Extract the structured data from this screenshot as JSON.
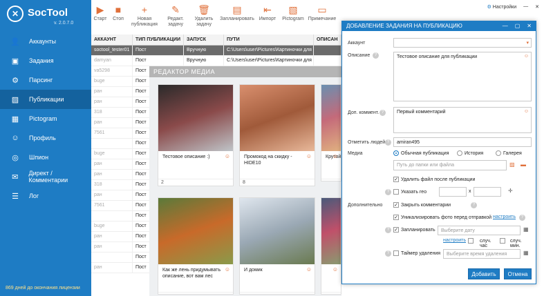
{
  "app": {
    "brand": "SocTool",
    "version": "v. 2.0.7.0",
    "license": "869 дней до окончания лицензии"
  },
  "sidebar": {
    "items": [
      {
        "label": "Аккаунты",
        "icon": "users-icon"
      },
      {
        "label": "Задания",
        "icon": "box-icon"
      },
      {
        "label": "Парсинг",
        "icon": "parse-icon"
      },
      {
        "label": "Публикации",
        "icon": "image-icon"
      },
      {
        "label": "Pictogram",
        "icon": "picture-icon"
      },
      {
        "label": "Профиль",
        "icon": "profile-icon"
      },
      {
        "label": "Шпион",
        "icon": "binoculars-icon"
      },
      {
        "label": "Директ / Комментарии",
        "icon": "mail-icon"
      },
      {
        "label": "Лог",
        "icon": "list-icon"
      }
    ]
  },
  "toolbar": {
    "start": "Старт",
    "stop": "Стоп",
    "new_pub": "Новая публикация",
    "edit_task": "Редакт. задачу",
    "delete_task": "Удалить задачу",
    "schedule": "Запланировать",
    "import": "Импорт",
    "pictogram": "Pictogram",
    "note": "Примечание",
    "settings": "Настройки"
  },
  "table": {
    "headers": [
      "АККАУНТ",
      "ТИП ПУБЛИКАЦИИ",
      "ЗАПУСК",
      "ПУТИ",
      "ОПИСАН"
    ],
    "rows": [
      [
        "soctool_tester01",
        "Пост",
        "Вручную",
        "C:\\Users\\user\\Pictures\\Картиночки для н",
        ""
      ],
      [
        "damyan",
        "Пост",
        "Вручную",
        "C:\\Users\\user\\Pictures\\Картиночки для н",
        ""
      ],
      [
        "va5298",
        "Пост",
        "",
        "",
        ""
      ],
      [
        "buge",
        "Пост",
        "",
        "",
        ""
      ],
      [
        "ран",
        "Пост",
        "",
        "",
        ""
      ],
      [
        "ран",
        "Пост",
        "",
        "",
        ""
      ],
      [
        "318",
        "Пост",
        "",
        "",
        ""
      ],
      [
        "ран",
        "Пост",
        "",
        "",
        ""
      ],
      [
        "7561",
        "Пост",
        "",
        "",
        ""
      ],
      [
        "",
        "Пост",
        "",
        "",
        ""
      ],
      [
        "buge",
        "Пост",
        "",
        "",
        ""
      ],
      [
        "ран",
        "Пост",
        "",
        "",
        ""
      ],
      [
        "ран",
        "Пост",
        "",
        "",
        ""
      ],
      [
        "318",
        "Пост",
        "",
        "",
        ""
      ],
      [
        "ран",
        "Пост",
        "",
        "",
        ""
      ],
      [
        "7561",
        "Пост",
        "",
        "",
        ""
      ],
      [
        "",
        "Пост",
        "",
        "",
        ""
      ],
      [
        "buge",
        "Пост",
        "",
        "",
        ""
      ],
      [
        "ран",
        "Пост",
        "",
        "",
        ""
      ],
      [
        "ран",
        "Пост",
        "",
        "",
        ""
      ],
      [
        "",
        "Пост",
        "",
        "",
        ""
      ],
      [
        "ран",
        "Пост",
        "",
        "",
        ""
      ]
    ]
  },
  "media": {
    "title": "РЕДАКТОР МЕДИА",
    "cards": [
      {
        "desc": "Тестовое описание :)",
        "num": "2",
        "colors": [
          "#2a2a2a",
          "#8a4a4a",
          "#bfc4c8"
        ]
      },
      {
        "desc": "Промокод на скидку - HIDE10",
        "num": "8",
        "colors": [
          "#d98f6e",
          "#a05a3a",
          "#e8b89a"
        ]
      },
      {
        "desc": "Крутой",
        "num": "",
        "colors": [
          "#6a8fb0",
          "#c46a7a",
          "#e0b080"
        ]
      },
      {
        "desc": "Как же лень придумывать описание, вот вам лес",
        "num": "",
        "colors": [
          "#5a7a3a",
          "#c86a2a",
          "#8a9a4a"
        ]
      },
      {
        "desc": "И домик",
        "num": "",
        "colors": [
          "#dfe6ee",
          "#9aa8b4",
          "#6a7a50"
        ]
      },
      {
        "desc": "",
        "num": "",
        "colors": [
          "#4a5a7a",
          "#c0506a",
          "#8a9a70"
        ]
      }
    ]
  },
  "dialog": {
    "title": "ДОБАВЛЕНИЕ ЗАДАНИЯ НА ПУБЛИКАЦИЮ",
    "account_label": "Аккаунт",
    "desc_label": "Описание",
    "desc_value": "Тестовое описание для публикации",
    "comment_label": "Доп. коммент.",
    "comment_value": "Первый комментарий",
    "tag_label": "Отметить людей",
    "tag_value": "amiran495",
    "media_label": "Медиа",
    "radio_regular": "Обычная публикация",
    "radio_story": "История",
    "radio_gallery": "Галерея",
    "path_placeholder": "Путь до папки или файла",
    "delete_after": "Удалить файл после публикации",
    "geo": "Указать гео",
    "geo_x": "x",
    "extra_label": "Дополнительно",
    "close_comments": "Закрыть комментарии",
    "uniq": "Уникализировать фото перед отправкой",
    "configure": "настроить",
    "schedule": "Запланировать",
    "date_placeholder": "Выберите дату",
    "configure2": "настроить",
    "rand_hour": "случ. час",
    "rand_min": "случ. мин.",
    "timer": "Таймер удаления",
    "timer_placeholder": "Выберите время удаления",
    "add": "Добавить",
    "cancel": "Отмена"
  }
}
